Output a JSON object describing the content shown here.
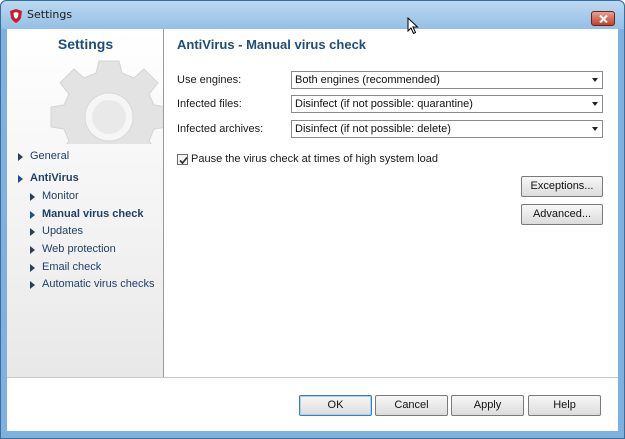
{
  "window": {
    "title": "Settings"
  },
  "sidebar": {
    "title": "Settings",
    "items": [
      {
        "label": "General",
        "level": 0,
        "active": false
      },
      {
        "label": "AntiVirus",
        "level": 0,
        "active": true
      },
      {
        "label": "Monitor",
        "level": 1,
        "active": false
      },
      {
        "label": "Manual virus check",
        "level": 1,
        "active": true
      },
      {
        "label": "Updates",
        "level": 1,
        "active": false
      },
      {
        "label": "Web protection",
        "level": 1,
        "active": false
      },
      {
        "label": "Email check",
        "level": 1,
        "active": false
      },
      {
        "label": "Automatic virus checks",
        "level": 1,
        "active": false
      }
    ]
  },
  "main": {
    "title": "AntiVirus - Manual virus check",
    "fields": [
      {
        "label": "Use engines:",
        "value": "Both engines (recommended)"
      },
      {
        "label": "Infected files:",
        "value": "Disinfect (if not possible: quarantine)"
      },
      {
        "label": "Infected archives:",
        "value": "Disinfect (if not possible: delete)"
      }
    ],
    "pause_checkbox": {
      "label": "Pause the virus check at times of high system load",
      "checked": true
    },
    "exceptions_button": "Exceptions...",
    "advanced_button": "Advanced..."
  },
  "footer": {
    "ok": "OK",
    "cancel": "Cancel",
    "apply": "Apply",
    "help": "Help"
  },
  "colors": {
    "accent": "#1e4d7b",
    "frame": "#7fb0de",
    "close": "#c3412a",
    "shield": "#c8202b"
  },
  "icons": {
    "app": "shield-icon",
    "close": "close-icon",
    "sidebar_art": "gear-icon",
    "checkbox": "check-icon"
  }
}
